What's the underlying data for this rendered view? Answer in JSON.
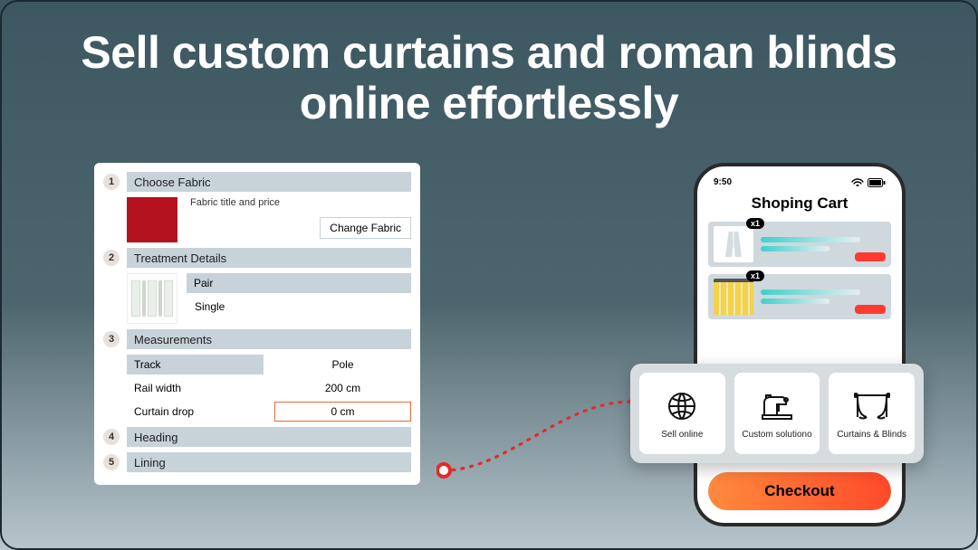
{
  "headline": "Sell custom curtains and roman blinds online effortlessly",
  "configurator": {
    "steps": [
      {
        "num": "1",
        "title": "Choose Fabric"
      },
      {
        "num": "2",
        "title": "Treatment Details"
      },
      {
        "num": "3",
        "title": "Measurements"
      },
      {
        "num": "4",
        "title": "Heading"
      },
      {
        "num": "5",
        "title": "Lining"
      }
    ],
    "fabric": {
      "subtitle": "Fabric title and price",
      "change_btn": "Change Fabric",
      "swatch_color": "#b4121f"
    },
    "treatment": {
      "options": [
        "Pair",
        "Single"
      ]
    },
    "measurements": {
      "colA": "Track",
      "colB": "Pole",
      "row1_label": "Rail width",
      "row1_value": "200 cm",
      "row2_label": "Curtain drop",
      "row2_value": "0 cm"
    }
  },
  "phone": {
    "time": "9:50",
    "title": "Shoping Cart",
    "qty_badge": "x1",
    "checkout": "Checkout"
  },
  "features": {
    "items": [
      {
        "label": "Sell online"
      },
      {
        "label": "Custom solutiono"
      },
      {
        "label": "Curtains & Blinds"
      }
    ]
  }
}
